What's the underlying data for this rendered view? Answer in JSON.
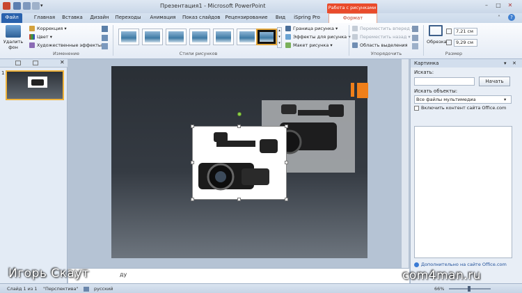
{
  "window": {
    "title": "Презентация1 - Microsoft PowerPoint",
    "context_tab": "Работа с рисунками"
  },
  "tabs": [
    "Файл",
    "Главная",
    "Вставка",
    "Дизайн",
    "Переходы",
    "Анимация",
    "Показ слайдов",
    "Рецензирование",
    "Вид",
    "iSpring Pro",
    "Формат"
  ],
  "ribbon": {
    "remove_bg": {
      "line1": "Удалить",
      "line2": "фон"
    },
    "adjust": {
      "correction": "Коррекция",
      "color": "Цвет",
      "artistic": "Художественные эффекты",
      "group_label": "Изменение"
    },
    "styles": {
      "group_label": "Стили рисунков"
    },
    "picture_opts": {
      "border": "Граница рисунка",
      "effects": "Эффекты для рисунка",
      "layout": "Макет рисунка"
    },
    "arrange": {
      "forward": "Переместить вперед",
      "backward": "Переместить назад",
      "selection_pane": "Область выделения",
      "group_label": "Упорядочить"
    },
    "size": {
      "crop": "Обрезка",
      "height": "7,21 см",
      "width": "9,29 см",
      "group_label": "Размер"
    }
  },
  "notes": {
    "text": "ду"
  },
  "clipart": {
    "title": "Картинка",
    "search_label": "Искать:",
    "search_value": "",
    "search_button": "Начать",
    "objects_label": "Искать объекты:",
    "objects_value": "Все файлы мультимедиа",
    "include_office": "Включить контент сайта Office.com",
    "more_link": "Дополнительно на сайте Office.com"
  },
  "status": {
    "slide": "Слайд 1 из 1",
    "theme": "\"Перспектива\"",
    "language": "русский",
    "zoom": "66%"
  },
  "slide_panel": {
    "slide_number": "1"
  },
  "watermarks": {
    "left": "Игорь Скаут",
    "right": "com4man.ru"
  },
  "colors": {
    "accent_orange": "#ef7f1a",
    "context_tab": "#e94b2b",
    "file_tab": "#2a62ad"
  }
}
